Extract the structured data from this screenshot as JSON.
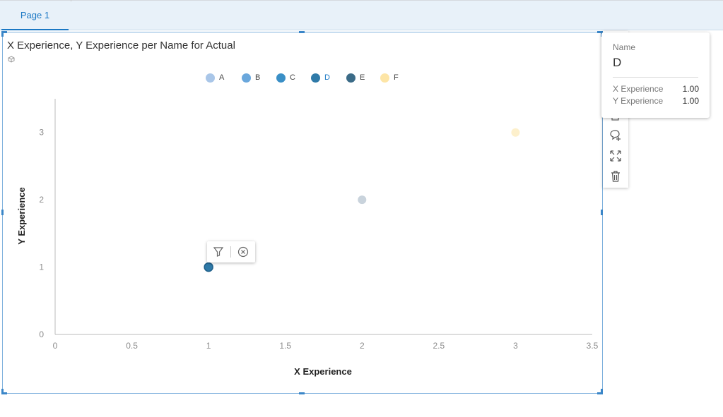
{
  "tabs": [
    {
      "label": "Page 1"
    }
  ],
  "widget": {
    "title": "X Experience, Y Experience per Name for Actual"
  },
  "legend": [
    {
      "label": "A",
      "color": "#a9c6e8"
    },
    {
      "label": "B",
      "color": "#6aa7dc"
    },
    {
      "label": "C",
      "color": "#3a8fc6"
    },
    {
      "label": "D",
      "color": "#2f7aa8",
      "active": true
    },
    {
      "label": "E",
      "color": "#3b6b87"
    },
    {
      "label": "F",
      "color": "#fde5a6"
    }
  ],
  "chart_data": {
    "type": "scatter",
    "xlabel": "X Experience",
    "ylabel": "Y Experience",
    "xlim": [
      0,
      3.5
    ],
    "ylim": [
      0,
      3.5
    ],
    "xticks": [
      "0",
      "0.5",
      "1",
      "1.5",
      "2",
      "2.5",
      "3",
      "3.5"
    ],
    "yticks": [
      "0",
      "1",
      "2",
      "3"
    ],
    "points": [
      {
        "name": "D",
        "x": 1,
        "y": 1,
        "color": "#2f7aa8"
      },
      {
        "name": "B",
        "x": 2,
        "y": 2,
        "color": "#c9d3dc"
      },
      {
        "name": "F",
        "x": 3,
        "y": 3,
        "color": "#fdf0cc"
      }
    ]
  },
  "tooltip": {
    "name_label": "Name",
    "name_value": "D",
    "rows": [
      {
        "label": "X Experience",
        "value": "1.00"
      },
      {
        "label": "Y Experience",
        "value": "1.00"
      }
    ]
  },
  "toolbar_icons": [
    "copy-icon",
    "comment-add-icon",
    "expand-icon",
    "trash-icon"
  ],
  "point_menu_icons": [
    "filter-icon",
    "exclude-icon"
  ]
}
